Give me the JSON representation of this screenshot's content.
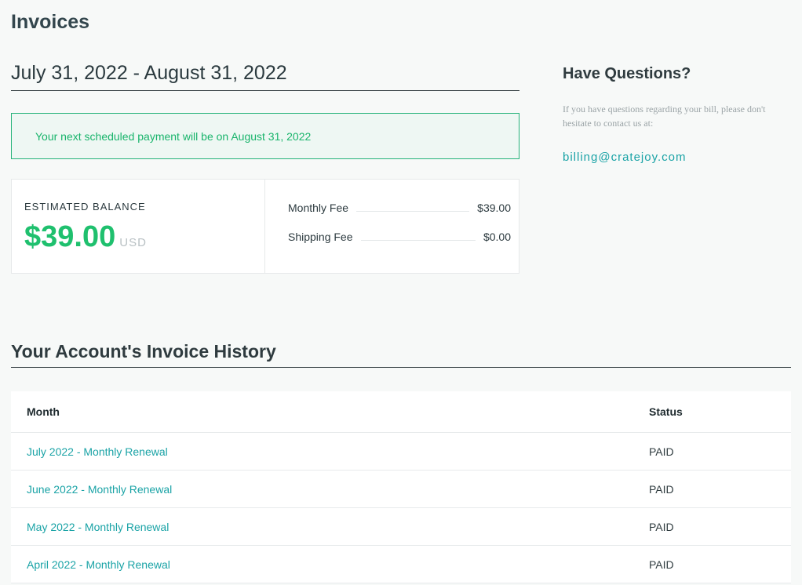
{
  "page": {
    "title": "Invoices"
  },
  "billing_period": {
    "title": "July 31, 2022 - August 31, 2022"
  },
  "notice": {
    "text": "Your next scheduled payment will be on August 31, 2022"
  },
  "balance": {
    "label": "ESTIMATED BALANCE",
    "amount": "$39.00",
    "currency": "USD",
    "fees": [
      {
        "label": "Monthly Fee",
        "value": "$39.00"
      },
      {
        "label": "Shipping Fee",
        "value": "$0.00"
      }
    ]
  },
  "questions": {
    "title": "Have Questions?",
    "text": "If you have questions regarding your bill, please don't hesitate to contact us at:",
    "email": "billing@cratejoy.com"
  },
  "history": {
    "title": "Your Account's Invoice History",
    "columns": {
      "month": "Month",
      "status": "Status"
    },
    "rows": [
      {
        "month": "July 2022 - Monthly Renewal",
        "status": "PAID"
      },
      {
        "month": "June 2022 - Monthly Renewal",
        "status": "PAID"
      },
      {
        "month": "May 2022 - Monthly Renewal",
        "status": "PAID"
      },
      {
        "month": "April 2022 - Monthly Renewal",
        "status": "PAID"
      }
    ]
  },
  "colors": {
    "accent_green": "#1fc06e",
    "link_teal": "#1aa3a6",
    "notice_border": "#27b37a",
    "background": "#f7f9f8"
  }
}
